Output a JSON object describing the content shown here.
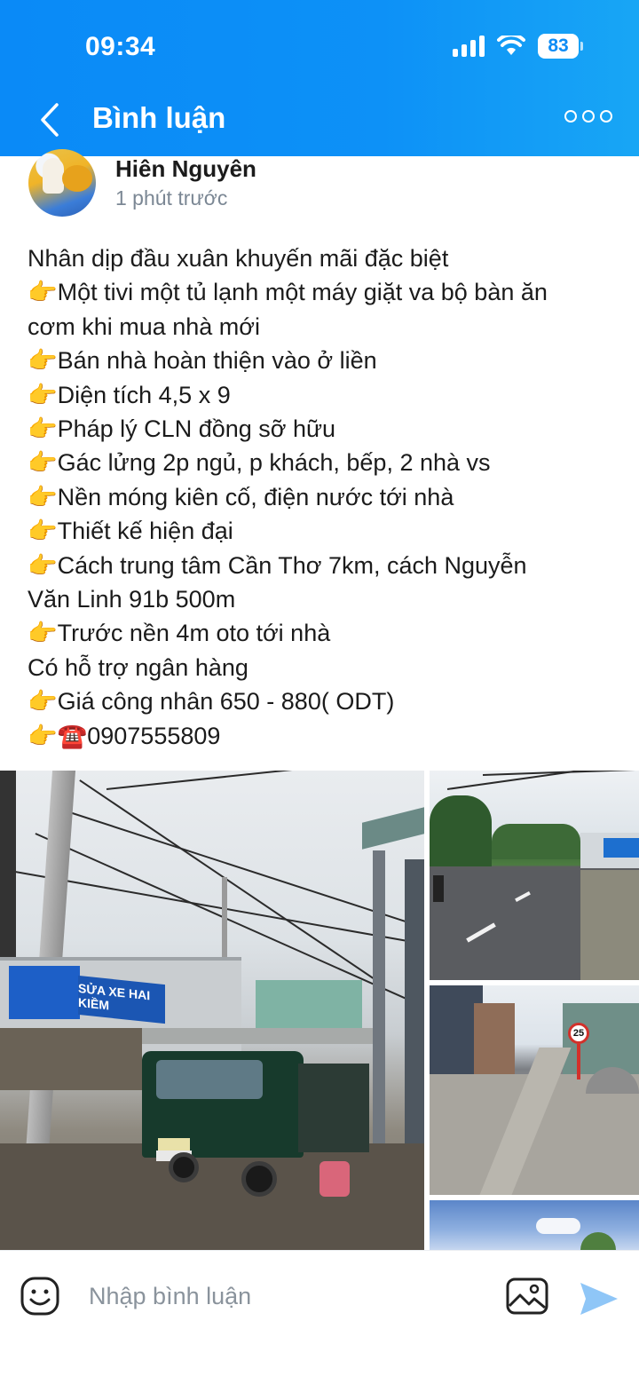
{
  "status_bar": {
    "time": "09:34",
    "battery": "83"
  },
  "header": {
    "title": "Bình luận"
  },
  "post": {
    "author": "Hiên Nguyên",
    "time": "1 phút trước",
    "lines": [
      "Nhân dịp đầu xuân khuyến mãi đặc biệt",
      " 👉Một tivi một tủ lạnh một máy giặt va bộ bàn ăn",
      "cơm khi mua nhà mới",
      "👉Bán nhà hoàn thiện vào ở liền",
      "👉Diện tích 4,5 x 9",
      "👉Pháp lý CLN đồng sỡ hữu",
      "👉Gác lửng 2p ngủ, p khách, bếp, 2 nhà vs",
      "👉Nền móng kiên cố, điện nước tới nhà",
      "👉Thiết kế hiện đại",
      "👉Cách trung tâm Cần Thơ 7km, cách Nguyễn",
      "Văn Linh 91b 500m",
      "👉Trước nền 4m oto tới nhà",
      "Có hỗ trợ ngân hàng",
      "👉Giá công nhân 650 - 880( ODT)",
      "👉☎️0907555809"
    ],
    "photo_main_sign": "SỬA XE HAI KIỀM",
    "photo_road2_sign": "25"
  },
  "comment_bar": {
    "placeholder": "Nhập bình luận"
  },
  "colors": {
    "header_blue": "#0a8af7",
    "send_icon": "#8fc6f7",
    "text_muted": "#7b8794"
  },
  "icons": [
    "back-icon",
    "more-icon",
    "signal-icon",
    "wifi-icon",
    "emoji-icon",
    "image-icon",
    "send-icon"
  ]
}
